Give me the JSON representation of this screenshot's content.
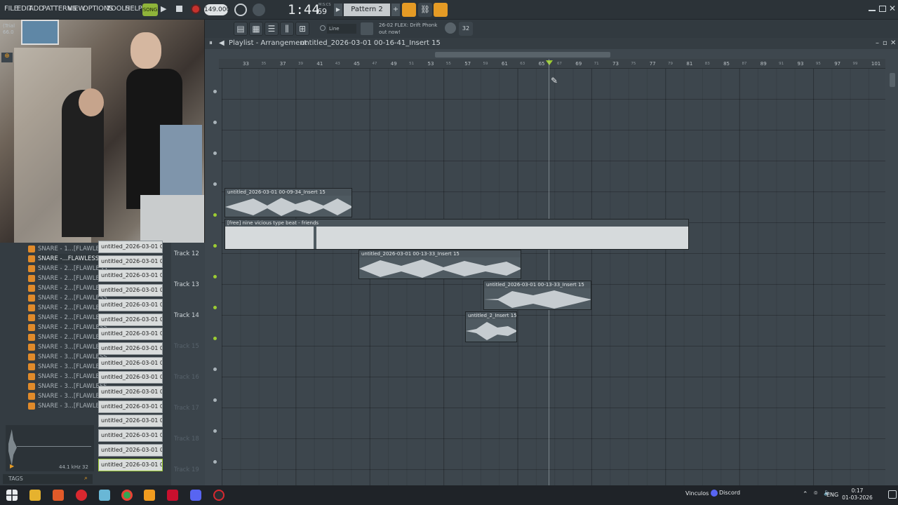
{
  "menu": [
    "FILE",
    "EDIT",
    "ADD",
    "PATTERNS",
    "VIEW",
    "OPTIONS",
    "TOOLS",
    "HELP"
  ],
  "transport": {
    "mode": "SONG",
    "tempo": "149.000",
    "time": "1:44",
    "time_sub": "69",
    "time_label": "M:S:CS",
    "pattern": "Pattern 2"
  },
  "hint": {
    "line1": "26-02  FLEX: Drift Phonk",
    "line2": "out now!"
  },
  "snap": "Line",
  "cpu": {
    "l1": "(Trial",
    "l2": "66.0"
  },
  "playlist": {
    "title": "Playlist - Arrangement",
    "path": "untitled_2026-03-01 00-16-41_Insert 15"
  },
  "ruler": [
    "33",
    "37",
    "41",
    "45",
    "49",
    "53",
    "57",
    "61",
    "65",
    "69",
    "73",
    "77",
    "81",
    "85",
    "89",
    "93",
    "97",
    "101"
  ],
  "ruler_minor": [
    "35",
    "39",
    "43",
    "47",
    "51",
    "55",
    "59",
    "63",
    "67",
    "71",
    "75",
    "79",
    "83",
    "87",
    "91",
    "95",
    "99"
  ],
  "tracks": [
    "Track 12",
    "Track 13",
    "Track 14",
    "Track 15",
    "Track 16",
    "Track 17",
    "Track 18",
    "Track 19"
  ],
  "clips": [
    {
      "name": "untitled_2026-03-01 00-09-34_Insert 15"
    },
    {
      "name": "[free] nine vicious type beat - friends"
    },
    {
      "name": "untitled_2026-03-01 00-13-33_Insert 15"
    },
    {
      "name": "untitled_2026-03-01 00-13-33_Insert 15"
    },
    {
      "name": "untitled_2_Insert 15"
    }
  ],
  "browser": {
    "items": [
      "SNARE - 1...[FLAWLESS]",
      "SNARE -...FLAWLESS]",
      "SNARE - 2...[FLAWLESS]",
      "SNARE - 2...[FLAWLESS]",
      "SNARE - 2...[FLAWLESS]",
      "SNARE - 2...[FLAWLESS]",
      "SNARE - 2...[FLAWLESS]",
      "SNARE - 2...[FLAWLESS]",
      "SNARE - 2...[FLAWLESS]",
      "SNARE - 2...[FLAWLESS]",
      "SNARE - 3...[FLAWLESS]",
      "SNARE - 3...[FLAWLESS]",
      "SNARE - 3...[FLAWLESS]",
      "SNARE - 3...[FLAWLESS]",
      "SNARE - 3...[FLAWLESS]",
      "SNARE - 3...[FLAWLESS]",
      "SNARE - 3...[FLAWLESS]"
    ],
    "tags": "TAGS",
    "sample_info": "44.1 kHz 32"
  },
  "channels": [
    "untitled_2026-03-01 00-...",
    "untitled_2026-03-01 00-...",
    "untitled_2026-03-01 00-...",
    "untitled_2026-03-01 00-...",
    "untitled_2026-03-01 00-...",
    "untitled_2026-03-01 00-...",
    "untitled_2026-03-01 00-...",
    "untitled_2026-03-01 00-...",
    "untitled_2026-03-01 00-...",
    "untitled_2026-03-01 00-...",
    "untitled_2026-03-01 00-...",
    "untitled_2026-03-01 00-...",
    "untitled_2026-03-01 00-...",
    "untitled_2026-03-01 00-...",
    "untitled_2026-03-01 00-...",
    "untitled_2026-03-01 00-..."
  ],
  "taskbar": {
    "tray1": "Vinculos",
    "tray2": "Discord",
    "lang": "ENG",
    "time": "0:17",
    "date": "01-03-2026"
  }
}
